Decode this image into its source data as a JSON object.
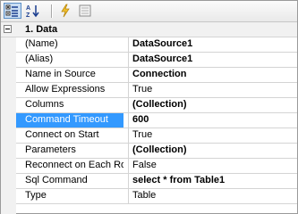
{
  "toolbar": {
    "buttons": [
      {
        "name": "categorized-view-button",
        "icon": "categorized-icon",
        "active": true
      },
      {
        "name": "alphabetical-sort-button",
        "icon": "sort-az-icon",
        "active": false
      },
      {
        "name": "events-button",
        "icon": "lightning-icon",
        "active": false
      },
      {
        "name": "property-pages-button",
        "icon": "property-pages-icon",
        "active": false
      }
    ]
  },
  "category": {
    "label": "1. Data",
    "expanded": true
  },
  "properties": [
    {
      "name": "(Name)",
      "value": "DataSource1",
      "bold": true,
      "selected": false
    },
    {
      "name": "(Alias)",
      "value": "DataSource1",
      "bold": true,
      "selected": false
    },
    {
      "name": "Name in Source",
      "value": "Connection",
      "bold": true,
      "selected": false
    },
    {
      "name": "Allow Expressions",
      "value": "True",
      "bold": false,
      "selected": false
    },
    {
      "name": "Columns",
      "value": "(Collection)",
      "bold": true,
      "selected": false
    },
    {
      "name": "Command Timeout",
      "value": "600",
      "bold": true,
      "selected": true
    },
    {
      "name": "Connect on Start",
      "value": "True",
      "bold": false,
      "selected": false
    },
    {
      "name": "Parameters",
      "value": "(Collection)",
      "bold": true,
      "selected": false
    },
    {
      "name": "Reconnect on Each Row",
      "value": "False",
      "bold": false,
      "selected": false
    },
    {
      "name": "Sql Command",
      "value": "select * from Table1",
      "bold": true,
      "selected": false
    },
    {
      "name": "Type",
      "value": "Table",
      "bold": false,
      "selected": false
    }
  ],
  "colors": {
    "selection": "#3399ff",
    "category_bg": "#f1f1f1",
    "grid_line": "#d4d4d4"
  }
}
